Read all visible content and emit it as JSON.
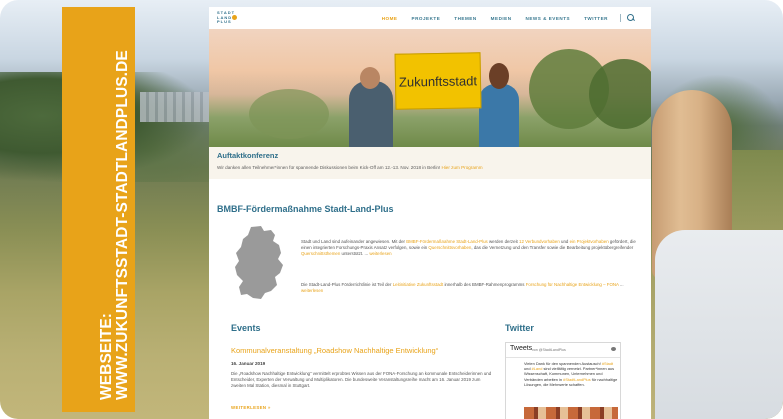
{
  "label": {
    "line1": "WEBSEITE:",
    "line2": "WWW.ZUKUNFTSSTADT-STADTLANDPLUS.DE"
  },
  "site": {
    "logo": [
      "STADT",
      "LAND",
      "PLUS"
    ],
    "nav": [
      {
        "label": "HOME",
        "active": true
      },
      {
        "label": "PROJEKTE",
        "active": false
      },
      {
        "label": "THEMEN",
        "active": false
      },
      {
        "label": "MEDIEN",
        "active": false
      },
      {
        "label": "NEWS & EVENTS",
        "active": false
      },
      {
        "label": "TWITTER",
        "active": false
      }
    ],
    "hero": {
      "sign_text": "Zukunftsstadt"
    },
    "conference": {
      "title": "Auftaktkonferenz",
      "text": "Wir danken allen Teilnehmer*innen für spannende Diskussionen beim Kick-Off am 12.-13. Nov. 2018 in Berlin!",
      "link": "Hier zum Programm"
    },
    "bmbf": {
      "title": "BMBF-Fördermaßnahme Stadt-Land-Plus",
      "p1_a": "Stadt und Land sind aufeinander angewiesen. Mit der",
      "p1_link1": "BMBF-Fördermaßnahme Stadt-Land-Plus",
      "p1_b": "werden derzeit",
      "p1_link2": "12 Verbundvorhaben",
      "p1_c": "und",
      "p1_link3": "ein Projektvorhaben",
      "p1_d": "gefördert, die einen integrierten Forschungs-Praxis Ansatz verfolgen, sowie ein",
      "p1_link4": "Querschnittsvorhaben",
      "p1_e": ", das die Vernetzung und den Transfer sowie die Bearbeitung projektübergreifender",
      "p1_link5": "Querschnittsthemen",
      "p1_f": "unterstützt. ...",
      "p1_more": "weiterlesen",
      "p2_a": "Die Stadt-Land-Plus Förderrichtlinie ist Teil der",
      "p2_link1": "Leitinitiative Zukunftsstadt",
      "p2_b": "innerhalb des BMBF-Rahmenprogramms",
      "p2_link2": "Forschung für Nachhaltige Entwicklung – FONA",
      "p2_c": "...",
      "p2_more": "weiterlesen"
    },
    "events": {
      "title": "Events",
      "event_title": "Kommunalveranstaltung „Roadshow Nachhaltige Entwicklung“",
      "date": "16. Januar 2019",
      "text": "Die „Roadshow Nachhaltige Entwicklung“ vermittelt erprobtes Wissen aus der FONA-Forschung an kommunale Entscheiderinnen und Entscheider, Experten der Verwaltung und Multiplikatoren. Die bundesweite Veranstaltungsreihe macht am 16. Januar 2019 zum zweiten Mal Station, diesmal in Stuttgart.",
      "more": "WEITERLESEN »"
    },
    "twitter": {
      "title": "Twitter",
      "widget_title": "Tweets",
      "handle": "von @StadtLandPlus",
      "tweet_a": "Vielen Dank für den spannenden Austausch!",
      "tweet_link1": "#Stadt",
      "tweet_b": "und",
      "tweet_link2": "#Land",
      "tweet_c": "sind vielfältig vernetzt. Partner*innen aus Wissenschaft, Kommunen, Unternehmen und Verbänden arbeiten in",
      "tweet_link3": "#StadtLandPlus",
      "tweet_d": "für nachhaltige Lösungen, die Mehrwerte schaffen."
    }
  }
}
